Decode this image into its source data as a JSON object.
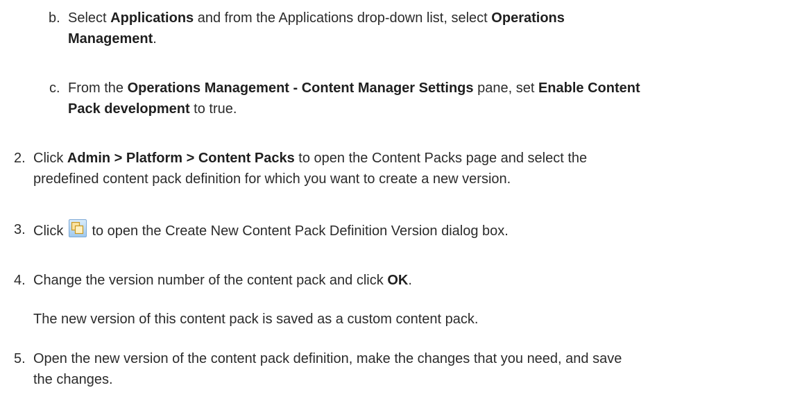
{
  "steps": {
    "b": {
      "marker": "b.",
      "t1": "Select ",
      "b1": "Applications",
      "t2": " and from the Applications drop-down list, select ",
      "b2": "Operations",
      "b3": "Management",
      "t3": "."
    },
    "c": {
      "marker": "c.",
      "t1": "From the ",
      "b1": "Operations Management - Content Manager Settings",
      "t2": " pane, set ",
      "b2": "Enable Content",
      "b3": "Pack development",
      "t3": " to true."
    },
    "s2": {
      "marker": "2.",
      "t1": "Click ",
      "b1": "Admin > Platform > Content Packs",
      "t2": " to open the Content Packs page and select the",
      "t3": "predefined content pack definition for which you want to create a new version."
    },
    "s3": {
      "marker": "3.",
      "t1": "Click ",
      "icon": "create-version-icon",
      "t2": " to open the Create New Content Pack Definition Version dialog box."
    },
    "s4": {
      "marker": "4.",
      "t1": "Change the version number of the content pack and click ",
      "b1": "OK",
      "t2": ".",
      "note": "The new version of this content pack is saved as a custom content pack."
    },
    "s5": {
      "marker": "5.",
      "t1": "Open the new version of the content pack definition, make the changes that you need, and save",
      "t2": "the changes."
    }
  }
}
